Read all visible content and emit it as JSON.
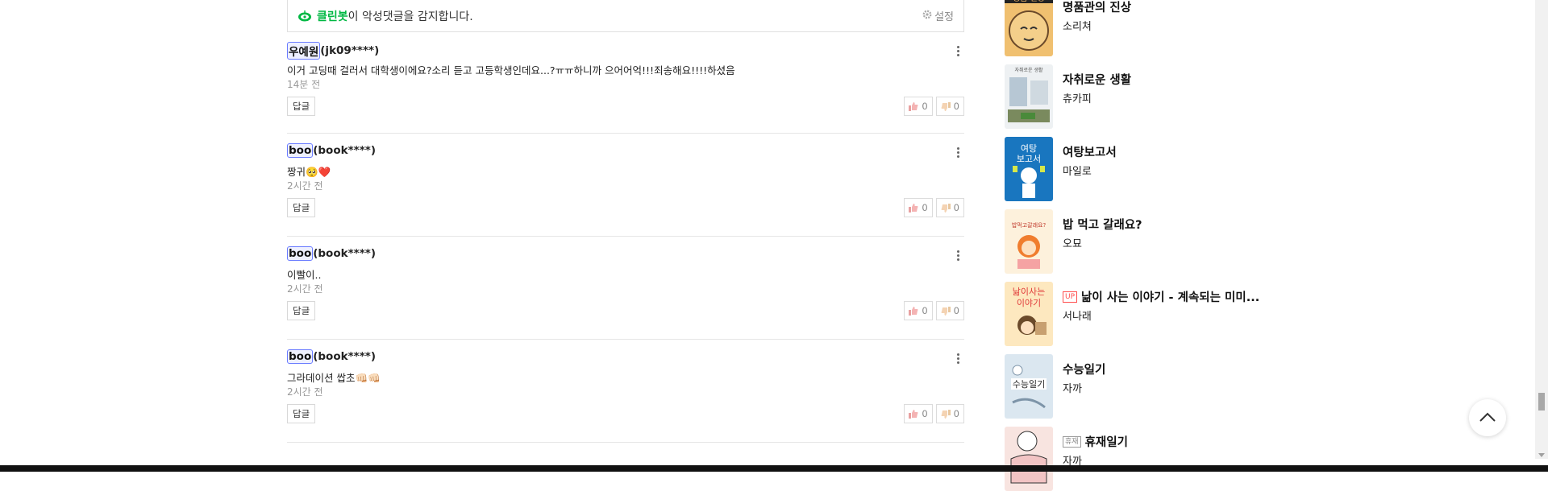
{
  "cleanbot": {
    "brand": "클린봇",
    "text": "이 악성댓글을 감지합니다.",
    "settings_label": "설정"
  },
  "comments": [
    {
      "nick": "우예원",
      "id": "(jk09****)",
      "body": "이거 고딩때 걸러서 대학생이에요?소리 듣고 고등학생인데요...?ㅠㅠ하니까 으어어억!!!죄송해요!!!!하셨음",
      "time": "14분 전",
      "reply": "답글",
      "likes": "0",
      "dislikes": "0"
    },
    {
      "nick": "boo",
      "id": "(book****)",
      "body": "짱귀🥺❤️",
      "time": "2시간 전",
      "reply": "답글",
      "likes": "0",
      "dislikes": "0"
    },
    {
      "nick": "boo",
      "id": "(book****)",
      "body": "이빨이..",
      "time": "2시간 전",
      "reply": "답글",
      "likes": "0",
      "dislikes": "0"
    },
    {
      "nick": "boo",
      "id": "(book****)",
      "body": "그라데이션 쌉초👊🏻👊🏻",
      "time": "2시간 전",
      "reply": "답글",
      "likes": "0",
      "dislikes": "0"
    }
  ],
  "sidebar": {
    "items": [
      {
        "title": "명품관의 진상",
        "author": "소리쳐",
        "badge": "",
        "thumb_text": "명품 진상"
      },
      {
        "title": "자취로운 생활",
        "author": "츄카피",
        "badge": "",
        "thumb_text": "자취로운 생활"
      },
      {
        "title": "여탕보고서",
        "author": "마일로",
        "badge": "",
        "thumb_text": "여탕 보고서"
      },
      {
        "title": "밥 먹고 갈래요?",
        "author": "오묘",
        "badge": "",
        "thumb_text": "밥먹고갈래요?"
      },
      {
        "title": "낢이 사는 이야기 - 계속되는 미미...",
        "author": "서나래",
        "badge": "UP",
        "thumb_text": "낢이 사는 이야기"
      },
      {
        "title": "수능일기",
        "author": "자까",
        "badge": "",
        "thumb_text": "수능일기"
      },
      {
        "title": "휴재일기",
        "author": "자까",
        "badge": "휴재",
        "thumb_text": ""
      }
    ]
  },
  "colors": {
    "brand_green": "#00b843",
    "nick_border": "#6a7cff",
    "up_badge": "#ff4d4d"
  },
  "icons": [
    "cleanbot-icon",
    "gear-icon",
    "more-vertical-icon",
    "thumbs-up-icon",
    "thumbs-down-icon",
    "arrow-up-icon"
  ]
}
